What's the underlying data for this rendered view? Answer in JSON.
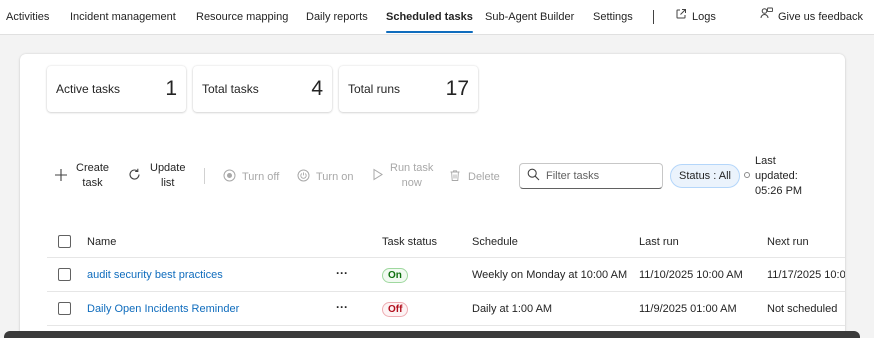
{
  "nav": {
    "items": [
      {
        "label": "Activities",
        "active": false
      },
      {
        "label": "Incident management",
        "active": false
      },
      {
        "label": "Resource mapping",
        "active": false
      },
      {
        "label": "Daily reports",
        "active": false
      },
      {
        "label": "Scheduled tasks",
        "active": true
      },
      {
        "label": "Sub-Agent Builder",
        "active": false
      },
      {
        "label": "Settings",
        "active": false
      }
    ],
    "logs_label": "Logs",
    "feedback_label": "Give us feedback",
    "accent_color": "#0f6cbd"
  },
  "stats": [
    {
      "label": "Active tasks",
      "value": "1"
    },
    {
      "label": "Total tasks",
      "value": "4"
    },
    {
      "label": "Total runs",
      "value": "17"
    }
  ],
  "toolbar": {
    "create": {
      "line1": "Create",
      "line2": "task",
      "icon": "plus-icon"
    },
    "update": {
      "line1": "Update",
      "line2": "list",
      "icon": "refresh-icon"
    },
    "turn_off": {
      "label": "Turn off",
      "icon": "stop-circle-icon",
      "disabled": true
    },
    "turn_on": {
      "label": "Turn on",
      "icon": "power-icon",
      "disabled": true
    },
    "run": {
      "line1": "Run task",
      "line2": "now",
      "icon": "play-icon",
      "disabled": true
    },
    "delete": {
      "label": "Delete",
      "icon": "trash-icon",
      "disabled": true
    },
    "filter_placeholder": "Filter tasks",
    "status_filter": "Status : All",
    "last_updated": {
      "line1": "Last",
      "line2": "updated:",
      "line3": "05:26 PM"
    }
  },
  "table": {
    "headers": {
      "name": "Name",
      "status": "Task status",
      "schedule": "Schedule",
      "last_run": "Last run",
      "next_run": "Next run"
    },
    "rows": [
      {
        "name": "audit security best practices",
        "more": "···",
        "status": "On",
        "schedule": "Weekly on Monday at 10:00 AM",
        "last_run": "11/10/2025 10:00 AM",
        "next_run": "11/17/2025 10:0"
      },
      {
        "name": "Daily Open Incidents Reminder",
        "more": "···",
        "status": "Off",
        "schedule": "Daily at 1:00 AM",
        "last_run": "11/9/2025 01:00 AM",
        "next_run": "Not scheduled"
      }
    ]
  }
}
